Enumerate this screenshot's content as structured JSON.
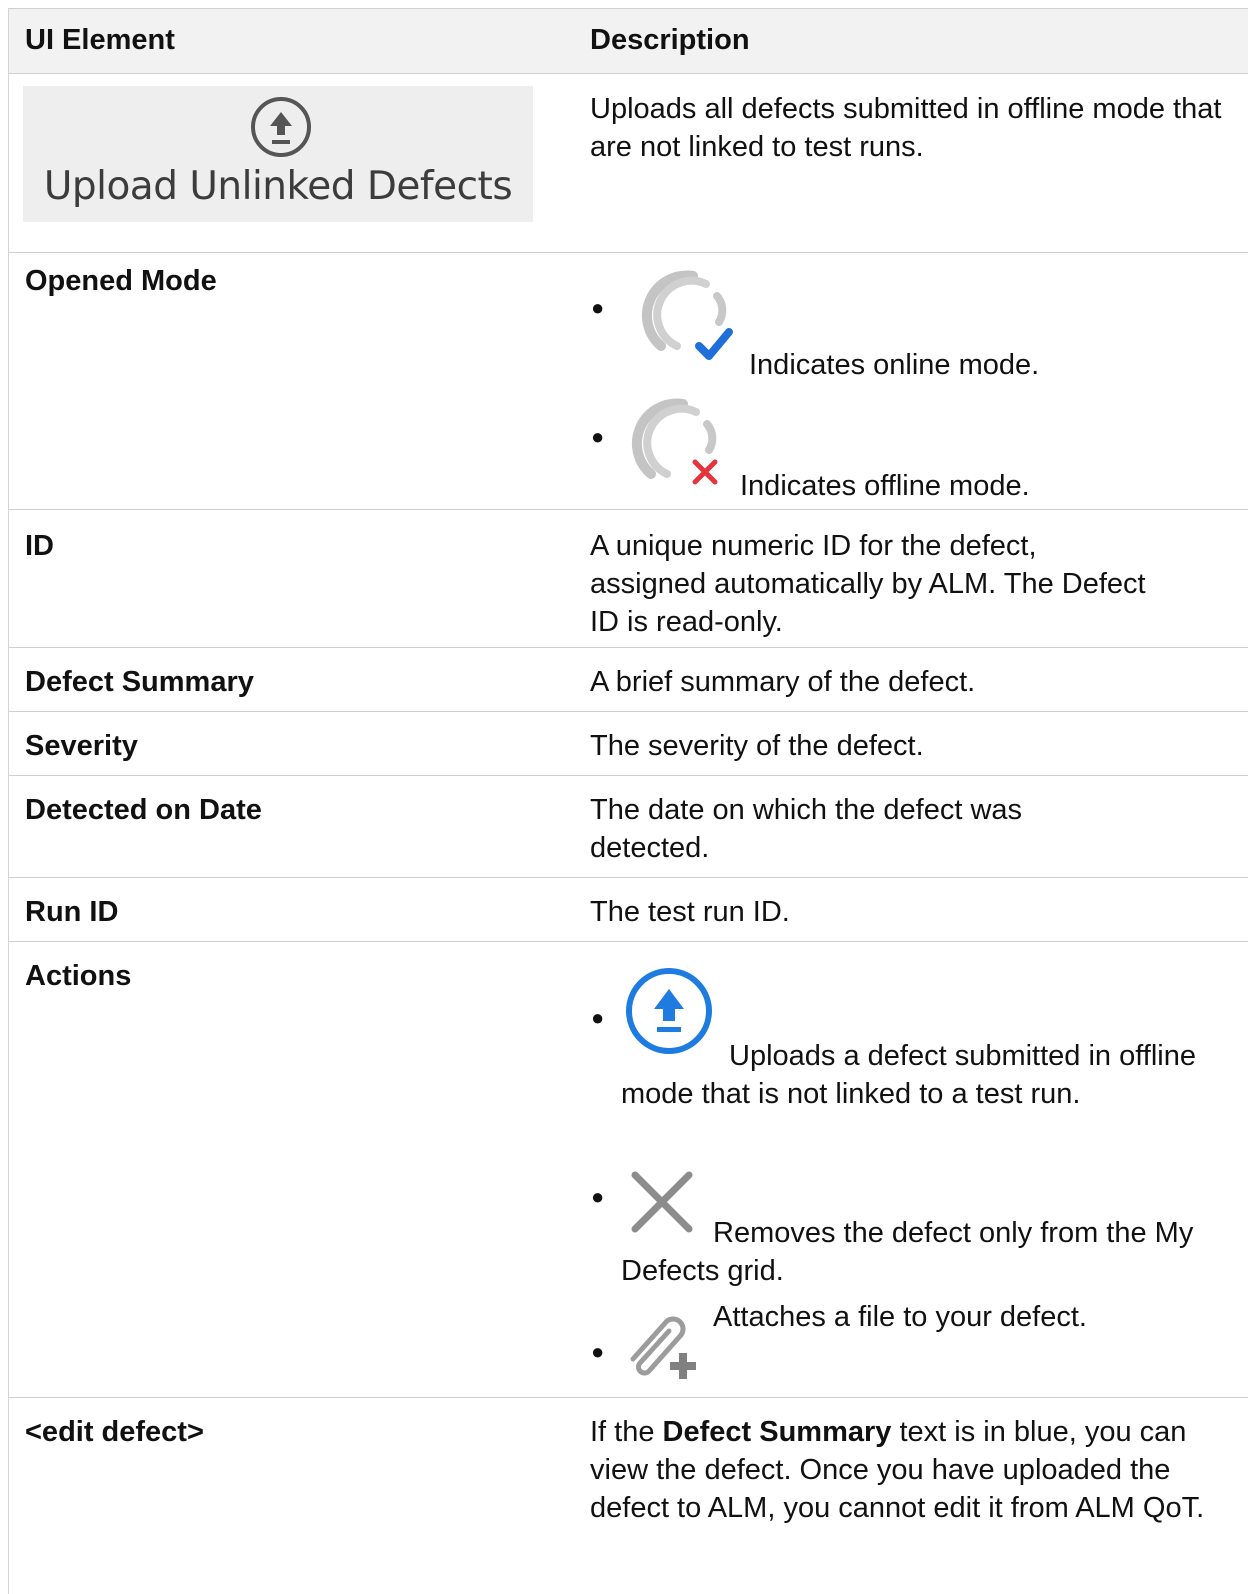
{
  "table": {
    "header": {
      "col1": "UI Element",
      "col2": "Description"
    },
    "upload_row": {
      "button_label": "Upload Unlinked Defects",
      "description": "Uploads all defects submitted in offline mode that are not linked to test runs."
    },
    "opened_mode": {
      "label": "Opened Mode",
      "online_text": "Indicates online mode.",
      "offline_text": "Indicates offline mode."
    },
    "id": {
      "label": "ID",
      "description": "A unique numeric ID for the defect, assigned automatically by ALM. The Defect ID is read-only."
    },
    "defect_summary": {
      "label": "Defect Summary",
      "description": "A brief summary of the defect."
    },
    "severity": {
      "label": "Severity",
      "description": "The severity of the defect."
    },
    "detected_on_date": {
      "label": "Detected on Date",
      "description": "The date on which the defect was detected."
    },
    "run_id": {
      "label": "Run ID",
      "description": "The test run ID."
    },
    "actions": {
      "label": "Actions",
      "upload_text": "Uploads a defect submitted in offline mode that is not linked to a test run.",
      "remove_text": "Removes the defect only from the My Defects grid.",
      "attach_text": "Attaches a file to your defect."
    },
    "edit_defect": {
      "label": "<edit defect>",
      "desc_prefix": "If the ",
      "desc_bold": "Defect Summary",
      "desc_suffix": " text is in blue, you can view the defect. Once you have uploaded the defect to ALM, you cannot edit it from ALM QoT."
    }
  },
  "icons": {
    "upload_unlinked": "upload-circle-icon",
    "online_mode": "sync-online-check-icon",
    "offline_mode": "sync-offline-x-icon",
    "upload_action": "upload-circle-blue-icon",
    "remove_action": "close-x-icon",
    "attach_action": "paperclip-plus-icon"
  },
  "colors": {
    "check": "#1e6fd9",
    "error_x": "#e5343b",
    "upload_blue": "#1e7be0",
    "icon_gray": "#bdbdbd"
  }
}
